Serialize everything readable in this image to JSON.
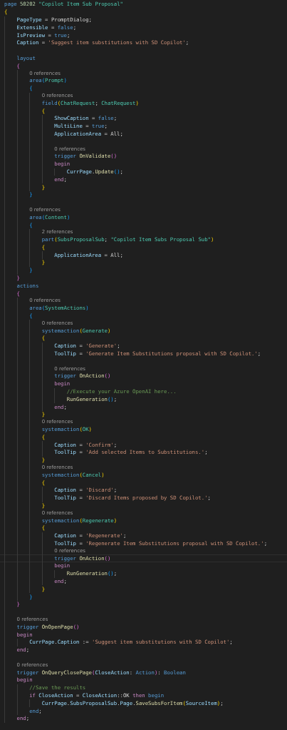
{
  "editor": {
    "lines": [
      {
        "kind": "code",
        "tokens": [
          {
            "kind": "keyword",
            "text": "page "
          },
          {
            "kind": "number",
            "text": "50202 "
          },
          {
            "kind": "type",
            "text": "\"Copilot Item Sub Proposal\""
          }
        ]
      },
      {
        "kind": "code",
        "tokens": [
          {
            "kind": "brace1",
            "text": "{"
          }
        ]
      },
      {
        "kind": "code",
        "tokens": [
          {
            "kind": "variable",
            "text": "    PageType"
          },
          {
            "kind": "plain",
            "text": " = PromptDialog;"
          }
        ]
      },
      {
        "kind": "code",
        "tokens": [
          {
            "kind": "variable",
            "text": "    Extensible"
          },
          {
            "kind": "plain",
            "text": " = "
          },
          {
            "kind": "keyword",
            "text": "false"
          },
          {
            "kind": "plain",
            "text": ";"
          }
        ]
      },
      {
        "kind": "code",
        "tokens": [
          {
            "kind": "variable",
            "text": "    IsPreview"
          },
          {
            "kind": "plain",
            "text": " = "
          },
          {
            "kind": "keyword",
            "text": "true"
          },
          {
            "kind": "plain",
            "text": ";"
          }
        ]
      },
      {
        "kind": "code",
        "tokens": [
          {
            "kind": "variable",
            "text": "    Caption"
          },
          {
            "kind": "plain",
            "text": " = "
          },
          {
            "kind": "string",
            "text": "'Suggest item substitutions with SD Copilot'"
          },
          {
            "kind": "plain",
            "text": ";"
          }
        ]
      },
      {
        "kind": "blank"
      },
      {
        "kind": "code",
        "tokens": [
          {
            "kind": "keyword",
            "text": "    layout"
          }
        ]
      },
      {
        "kind": "code",
        "tokens": [
          {
            "kind": "brace2",
            "text": "    {"
          }
        ]
      },
      {
        "kind": "lens",
        "text": "        0 references"
      },
      {
        "kind": "code",
        "tokens": [
          {
            "kind": "keyword",
            "text": "        area"
          },
          {
            "kind": "brace3",
            "text": "("
          },
          {
            "kind": "type",
            "text": "Prompt"
          },
          {
            "kind": "brace3",
            "text": ")"
          }
        ]
      },
      {
        "kind": "code",
        "tokens": [
          {
            "kind": "brace3",
            "text": "        {"
          }
        ]
      },
      {
        "kind": "lens",
        "text": "            0 references"
      },
      {
        "kind": "code",
        "tokens": [
          {
            "kind": "keyword",
            "text": "            field"
          },
          {
            "kind": "brace1",
            "text": "("
          },
          {
            "kind": "type",
            "text": "ChatRequest"
          },
          {
            "kind": "plain",
            "text": "; "
          },
          {
            "kind": "type",
            "text": "ChatRequest"
          },
          {
            "kind": "brace1",
            "text": ")"
          }
        ]
      },
      {
        "kind": "code",
        "tokens": [
          {
            "kind": "brace1",
            "text": "            {"
          }
        ]
      },
      {
        "kind": "code",
        "tokens": [
          {
            "kind": "variable",
            "text": "                ShowCaption"
          },
          {
            "kind": "plain",
            "text": " = "
          },
          {
            "kind": "keyword",
            "text": "false"
          },
          {
            "kind": "plain",
            "text": ";"
          }
        ]
      },
      {
        "kind": "code",
        "tokens": [
          {
            "kind": "variable",
            "text": "                MultiLine"
          },
          {
            "kind": "plain",
            "text": " = "
          },
          {
            "kind": "keyword",
            "text": "true"
          },
          {
            "kind": "plain",
            "text": ";"
          }
        ]
      },
      {
        "kind": "code",
        "tokens": [
          {
            "kind": "variable",
            "text": "                ApplicationArea"
          },
          {
            "kind": "plain",
            "text": " = All;"
          }
        ]
      },
      {
        "kind": "blank"
      },
      {
        "kind": "lens",
        "text": "                0 references"
      },
      {
        "kind": "code",
        "tokens": [
          {
            "kind": "keyword",
            "text": "                trigger "
          },
          {
            "kind": "function",
            "text": "OnValidate"
          },
          {
            "kind": "brace2",
            "text": "()"
          }
        ]
      },
      {
        "kind": "code",
        "tokens": [
          {
            "kind": "control",
            "text": "                begin"
          }
        ]
      },
      {
        "kind": "code",
        "tokens": [
          {
            "kind": "variable",
            "text": "                    CurrPage"
          },
          {
            "kind": "plain",
            "text": "."
          },
          {
            "kind": "function",
            "text": "Update"
          },
          {
            "kind": "brace3",
            "text": "()"
          },
          {
            "kind": "plain",
            "text": ";"
          }
        ]
      },
      {
        "kind": "code",
        "tokens": [
          {
            "kind": "control",
            "text": "                end"
          },
          {
            "kind": "plain",
            "text": ";"
          }
        ]
      },
      {
        "kind": "code",
        "tokens": [
          {
            "kind": "brace1",
            "text": "            }"
          }
        ]
      },
      {
        "kind": "code",
        "tokens": [
          {
            "kind": "brace3",
            "text": "        }"
          }
        ]
      },
      {
        "kind": "blank"
      },
      {
        "kind": "lens",
        "text": "        0 references"
      },
      {
        "kind": "code",
        "tokens": [
          {
            "kind": "keyword",
            "text": "        area"
          },
          {
            "kind": "brace3",
            "text": "("
          },
          {
            "kind": "type",
            "text": "Content"
          },
          {
            "kind": "brace3",
            "text": ")"
          }
        ]
      },
      {
        "kind": "code",
        "tokens": [
          {
            "kind": "brace3",
            "text": "        {"
          }
        ]
      },
      {
        "kind": "lens",
        "text": "            2 references"
      },
      {
        "kind": "code",
        "tokens": [
          {
            "kind": "keyword",
            "text": "            part"
          },
          {
            "kind": "brace1",
            "text": "("
          },
          {
            "kind": "type",
            "text": "SubsProposalSub"
          },
          {
            "kind": "plain",
            "text": "; "
          },
          {
            "kind": "type",
            "text": "\"Copilot Item Subs Proposal Sub\""
          },
          {
            "kind": "brace1",
            "text": ")"
          }
        ]
      },
      {
        "kind": "code",
        "tokens": [
          {
            "kind": "brace1",
            "text": "            {"
          }
        ]
      },
      {
        "kind": "code",
        "tokens": [
          {
            "kind": "variable",
            "text": "                ApplicationArea"
          },
          {
            "kind": "plain",
            "text": " = All;"
          }
        ]
      },
      {
        "kind": "code",
        "tokens": [
          {
            "kind": "brace1",
            "text": "            }"
          }
        ]
      },
      {
        "kind": "code",
        "tokens": [
          {
            "kind": "brace3",
            "text": "        }"
          }
        ]
      },
      {
        "kind": "code",
        "tokens": [
          {
            "kind": "brace2",
            "text": "    }"
          }
        ]
      },
      {
        "kind": "code",
        "tokens": [
          {
            "kind": "keyword",
            "text": "    actions"
          }
        ]
      },
      {
        "kind": "code",
        "tokens": [
          {
            "kind": "brace2",
            "text": "    {"
          }
        ]
      },
      {
        "kind": "lens",
        "text": "        0 references"
      },
      {
        "kind": "code",
        "tokens": [
          {
            "kind": "keyword",
            "text": "        area"
          },
          {
            "kind": "brace3",
            "text": "("
          },
          {
            "kind": "type",
            "text": "SystemActions"
          },
          {
            "kind": "brace3",
            "text": ")"
          }
        ]
      },
      {
        "kind": "code",
        "tokens": [
          {
            "kind": "brace3",
            "text": "        {"
          }
        ]
      },
      {
        "kind": "lens",
        "text": "            0 references"
      },
      {
        "kind": "code",
        "tokens": [
          {
            "kind": "keyword",
            "text": "            systemaction"
          },
          {
            "kind": "brace1",
            "text": "("
          },
          {
            "kind": "type",
            "text": "Generate"
          },
          {
            "kind": "brace1",
            "text": ")"
          }
        ]
      },
      {
        "kind": "code",
        "tokens": [
          {
            "kind": "brace1",
            "text": "            {"
          }
        ]
      },
      {
        "kind": "code",
        "tokens": [
          {
            "kind": "variable",
            "text": "                Caption"
          },
          {
            "kind": "plain",
            "text": " = "
          },
          {
            "kind": "string",
            "text": "'Generate'"
          },
          {
            "kind": "plain",
            "text": ";"
          }
        ]
      },
      {
        "kind": "code",
        "tokens": [
          {
            "kind": "variable",
            "text": "                ToolTip"
          },
          {
            "kind": "plain",
            "text": " = "
          },
          {
            "kind": "string",
            "text": "'Generate Item Substitutions proposal with SD Copilot.'"
          },
          {
            "kind": "plain",
            "text": ";"
          }
        ]
      },
      {
        "kind": "blank"
      },
      {
        "kind": "lens",
        "text": "                0 references"
      },
      {
        "kind": "code",
        "tokens": [
          {
            "kind": "keyword",
            "text": "                trigger "
          },
          {
            "kind": "function",
            "text": "OnAction"
          },
          {
            "kind": "brace2",
            "text": "()"
          }
        ]
      },
      {
        "kind": "code",
        "tokens": [
          {
            "kind": "control",
            "text": "                begin"
          }
        ]
      },
      {
        "kind": "code",
        "tokens": [
          {
            "kind": "comment",
            "text": "                    //Execute your Azure OpenAI here..."
          }
        ]
      },
      {
        "kind": "code",
        "tokens": [
          {
            "kind": "function",
            "text": "                    RunGeneration"
          },
          {
            "kind": "brace3",
            "text": "()"
          },
          {
            "kind": "plain",
            "text": ";"
          }
        ]
      },
      {
        "kind": "code",
        "tokens": [
          {
            "kind": "control",
            "text": "                end"
          },
          {
            "kind": "plain",
            "text": ";"
          }
        ]
      },
      {
        "kind": "code",
        "tokens": [
          {
            "kind": "brace1",
            "text": "            }"
          }
        ]
      },
      {
        "kind": "lens",
        "text": "            0 references"
      },
      {
        "kind": "code",
        "tokens": [
          {
            "kind": "keyword",
            "text": "            systemaction"
          },
          {
            "kind": "brace1",
            "text": "("
          },
          {
            "kind": "type",
            "text": "OK"
          },
          {
            "kind": "brace1",
            "text": ")"
          }
        ]
      },
      {
        "kind": "code",
        "tokens": [
          {
            "kind": "brace1",
            "text": "            {"
          }
        ]
      },
      {
        "kind": "code",
        "tokens": [
          {
            "kind": "variable",
            "text": "                Caption"
          },
          {
            "kind": "plain",
            "text": " = "
          },
          {
            "kind": "string",
            "text": "'Confirm'"
          },
          {
            "kind": "plain",
            "text": ";"
          }
        ]
      },
      {
        "kind": "code",
        "tokens": [
          {
            "kind": "variable",
            "text": "                ToolTip"
          },
          {
            "kind": "plain",
            "text": " = "
          },
          {
            "kind": "string",
            "text": "'Add selected Items to Substitutions.'"
          },
          {
            "kind": "plain",
            "text": ";"
          }
        ]
      },
      {
        "kind": "code",
        "tokens": [
          {
            "kind": "brace1",
            "text": "            }"
          }
        ]
      },
      {
        "kind": "lens",
        "text": "            0 references"
      },
      {
        "kind": "code",
        "tokens": [
          {
            "kind": "keyword",
            "text": "            systemaction"
          },
          {
            "kind": "brace1",
            "text": "("
          },
          {
            "kind": "type",
            "text": "Cancel"
          },
          {
            "kind": "brace1",
            "text": ")"
          }
        ]
      },
      {
        "kind": "code",
        "tokens": [
          {
            "kind": "brace1",
            "text": "            {"
          }
        ]
      },
      {
        "kind": "code",
        "tokens": [
          {
            "kind": "variable",
            "text": "                Caption"
          },
          {
            "kind": "plain",
            "text": " = "
          },
          {
            "kind": "string",
            "text": "'Discard'"
          },
          {
            "kind": "plain",
            "text": ";"
          }
        ]
      },
      {
        "kind": "code",
        "tokens": [
          {
            "kind": "variable",
            "text": "                ToolTip"
          },
          {
            "kind": "plain",
            "text": " = "
          },
          {
            "kind": "string",
            "text": "'Discard Items proposed by SD Copilot.'"
          },
          {
            "kind": "plain",
            "text": ";"
          }
        ]
      },
      {
        "kind": "code",
        "tokens": [
          {
            "kind": "brace1",
            "text": "            }"
          }
        ]
      },
      {
        "kind": "lens",
        "text": "            0 references"
      },
      {
        "kind": "code",
        "tokens": [
          {
            "kind": "keyword",
            "text": "            systemaction"
          },
          {
            "kind": "brace1",
            "text": "("
          },
          {
            "kind": "type",
            "text": "Regenerate"
          },
          {
            "kind": "brace1",
            "text": ")"
          }
        ]
      },
      {
        "kind": "code",
        "tokens": [
          {
            "kind": "brace1",
            "text": "            {"
          }
        ]
      },
      {
        "kind": "code",
        "tokens": [
          {
            "kind": "variable",
            "text": "                Caption"
          },
          {
            "kind": "plain",
            "text": " = "
          },
          {
            "kind": "string",
            "text": "'Regenerate'"
          },
          {
            "kind": "plain",
            "text": ";"
          }
        ]
      },
      {
        "kind": "code",
        "tokens": [
          {
            "kind": "variable",
            "text": "                ToolTip"
          },
          {
            "kind": "plain",
            "text": " = "
          },
          {
            "kind": "string",
            "text": "'Regenerate Item Substitutions proposal with SD Copilot.'"
          },
          {
            "kind": "plain",
            "text": ";"
          }
        ]
      },
      {
        "kind": "lens",
        "text": "                0 references"
      },
      {
        "kind": "code",
        "current": true,
        "tokens": [
          {
            "kind": "keyword",
            "text": "                trigger "
          },
          {
            "kind": "function",
            "text": "OnAction"
          },
          {
            "kind": "brace2",
            "text": "()"
          }
        ]
      },
      {
        "kind": "code",
        "tokens": [
          {
            "kind": "control",
            "text": "                begin"
          }
        ]
      },
      {
        "kind": "code",
        "tokens": [
          {
            "kind": "function",
            "text": "                    RunGeneration"
          },
          {
            "kind": "brace3",
            "text": "()"
          },
          {
            "kind": "plain",
            "text": ";"
          }
        ]
      },
      {
        "kind": "code",
        "tokens": [
          {
            "kind": "control",
            "text": "                end"
          },
          {
            "kind": "plain",
            "text": ";"
          }
        ]
      },
      {
        "kind": "code",
        "tokens": [
          {
            "kind": "brace1",
            "text": "            }"
          }
        ]
      },
      {
        "kind": "code",
        "tokens": [
          {
            "kind": "brace3",
            "text": "        }"
          }
        ]
      },
      {
        "kind": "code",
        "tokens": [
          {
            "kind": "brace2",
            "text": "    }"
          }
        ]
      },
      {
        "kind": "blank"
      },
      {
        "kind": "lens",
        "text": "    0 references"
      },
      {
        "kind": "code",
        "tokens": [
          {
            "kind": "keyword",
            "text": "    trigger "
          },
          {
            "kind": "function",
            "text": "OnOpenPage"
          },
          {
            "kind": "brace2",
            "text": "()"
          }
        ]
      },
      {
        "kind": "code",
        "tokens": [
          {
            "kind": "control",
            "text": "    begin"
          }
        ]
      },
      {
        "kind": "code",
        "tokens": [
          {
            "kind": "variable",
            "text": "        CurrPage"
          },
          {
            "kind": "plain",
            "text": "."
          },
          {
            "kind": "variable",
            "text": "Caption"
          },
          {
            "kind": "plain",
            "text": " := "
          },
          {
            "kind": "string",
            "text": "'Suggest item substitutions with SD Copilot'"
          },
          {
            "kind": "plain",
            "text": ";"
          }
        ]
      },
      {
        "kind": "code",
        "tokens": [
          {
            "kind": "control",
            "text": "    end"
          },
          {
            "kind": "plain",
            "text": ";"
          }
        ]
      },
      {
        "kind": "blank"
      },
      {
        "kind": "lens",
        "text": "    0 references"
      },
      {
        "kind": "code",
        "tokens": [
          {
            "kind": "keyword",
            "text": "    trigger "
          },
          {
            "kind": "function",
            "text": "OnQueryClosePage"
          },
          {
            "kind": "brace2",
            "text": "("
          },
          {
            "kind": "variable",
            "text": "CloseAction"
          },
          {
            "kind": "plain",
            "text": ": "
          },
          {
            "kind": "keyword",
            "text": "Action"
          },
          {
            "kind": "brace2",
            "text": ")"
          },
          {
            "kind": "plain",
            "text": ": "
          },
          {
            "kind": "keyword",
            "text": "Boolean"
          }
        ]
      },
      {
        "kind": "code",
        "tokens": [
          {
            "kind": "control",
            "text": "    begin"
          }
        ]
      },
      {
        "kind": "code",
        "tokens": [
          {
            "kind": "comment",
            "text": "        //Save the results"
          }
        ]
      },
      {
        "kind": "code",
        "tokens": [
          {
            "kind": "control",
            "text": "        if "
          },
          {
            "kind": "variable",
            "text": "CloseAction"
          },
          {
            "kind": "plain",
            "text": " = "
          },
          {
            "kind": "variable",
            "text": "CloseAction"
          },
          {
            "kind": "plain",
            "text": "::OK "
          },
          {
            "kind": "control",
            "text": "then "
          },
          {
            "kind": "keyword",
            "text": "begin"
          }
        ]
      },
      {
        "kind": "code",
        "tokens": [
          {
            "kind": "variable",
            "text": "            CurrPage"
          },
          {
            "kind": "plain",
            "text": "."
          },
          {
            "kind": "variable",
            "text": "SubsProposalSub"
          },
          {
            "kind": "plain",
            "text": "."
          },
          {
            "kind": "variable",
            "text": "Page"
          },
          {
            "kind": "plain",
            "text": "."
          },
          {
            "kind": "function",
            "text": "SaveSubsForItem"
          },
          {
            "kind": "brace1",
            "text": "("
          },
          {
            "kind": "variable",
            "text": "SourceItem"
          },
          {
            "kind": "brace1",
            "text": ")"
          },
          {
            "kind": "plain",
            "text": ";"
          }
        ]
      },
      {
        "kind": "code",
        "tokens": [
          {
            "kind": "keyword",
            "text": "        end"
          },
          {
            "kind": "plain",
            "text": ";"
          }
        ]
      },
      {
        "kind": "code",
        "tokens": [
          {
            "kind": "control",
            "text": "    end"
          },
          {
            "kind": "plain",
            "text": ";"
          }
        ]
      }
    ]
  }
}
